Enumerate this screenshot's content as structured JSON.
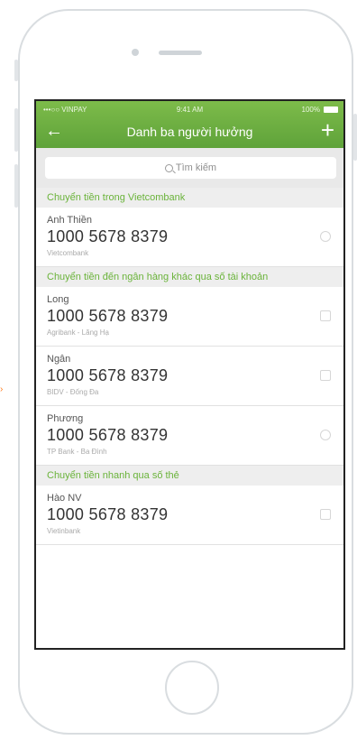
{
  "status_bar": {
    "carrier": "•••○○ VINPAY",
    "time": "9:41 AM",
    "battery": "100%"
  },
  "header": {
    "title": "Danh ba người hưởng",
    "back_icon": "arrow-left-icon",
    "add_icon": "plus-icon"
  },
  "search": {
    "placeholder": "Tìm kiếm"
  },
  "sections": [
    {
      "title": "Chuyển tiền trong Vietcombank",
      "rows": [
        {
          "name": "Anh Thiền",
          "account": "1000 5678 8379",
          "bank": "Vietcombank",
          "icon": "coin-icon"
        }
      ]
    },
    {
      "title": "Chuyển tiền đến ngân hàng khác qua số tài khoản",
      "rows": [
        {
          "name": "Long",
          "account": "1000 5678 8379",
          "bank": "Agribank - Lăng Hạ",
          "icon": "card-icon"
        },
        {
          "name": "Ngân",
          "account": "1000 5678 8379",
          "bank": "BIDV - Đống Đa",
          "icon": "card-icon"
        },
        {
          "name": "Phương",
          "account": "1000 5678 8379",
          "bank": "TP Bank - Ba Đình",
          "icon": "coin-icon"
        }
      ]
    },
    {
      "title": "Chuyển tiền nhanh qua số thẻ",
      "rows": [
        {
          "name": "Hào NV",
          "account": "1000 5678 8379",
          "bank": "Vietinbank",
          "icon": "card-icon"
        }
      ]
    }
  ],
  "colors": {
    "accent": "#6ab33a",
    "nav_bg": "#6aab40"
  }
}
